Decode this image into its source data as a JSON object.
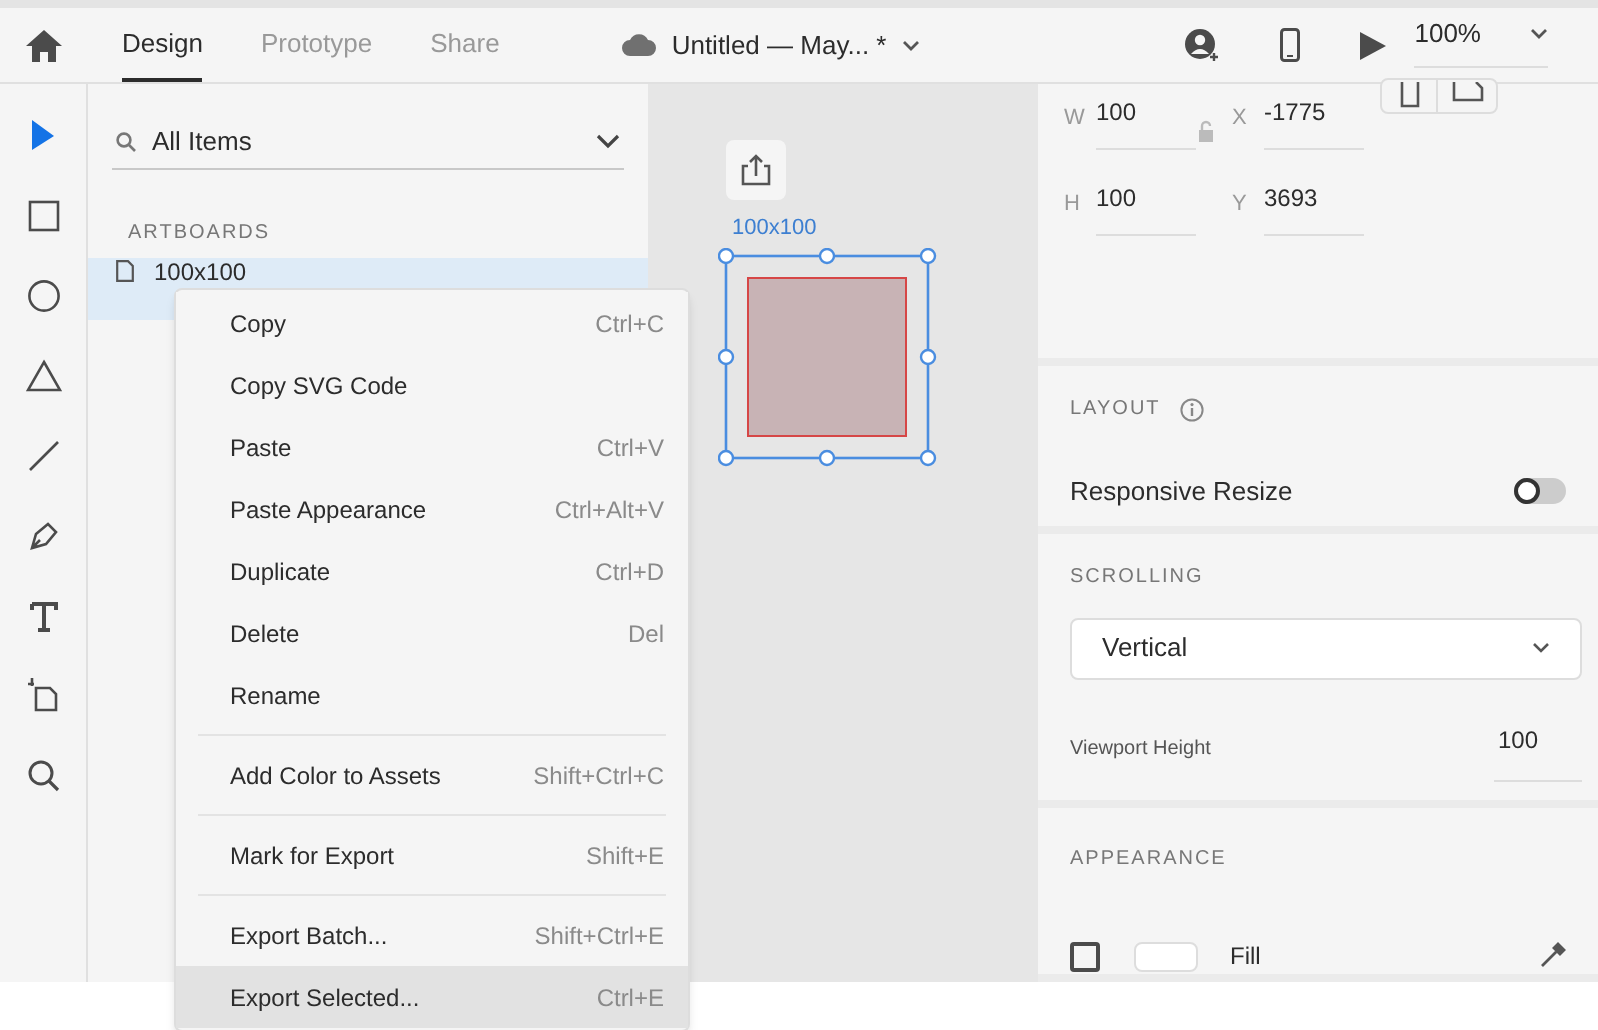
{
  "tabs": [
    {
      "label": "Design",
      "selected": true
    },
    {
      "label": "Prototype",
      "selected": false
    },
    {
      "label": "Share",
      "selected": false
    }
  ],
  "document_title": "Untitled — May... *",
  "zoom": "100%",
  "tools": [
    {
      "kind": "select",
      "selected": true
    },
    {
      "kind": "rectangle",
      "selected": false
    },
    {
      "kind": "ellipse",
      "selected": false
    },
    {
      "kind": "polygon",
      "selected": false
    },
    {
      "kind": "line",
      "selected": false
    },
    {
      "kind": "pen",
      "selected": false
    },
    {
      "kind": "text",
      "selected": false
    },
    {
      "kind": "artboard",
      "selected": false
    },
    {
      "kind": "zoom",
      "selected": false
    }
  ],
  "layers": {
    "filter": "All Items",
    "section": "ARTBOARDS",
    "items": [
      {
        "label": "100x100",
        "selected": true
      }
    ]
  },
  "canvas": {
    "artboard_label": "100x100"
  },
  "properties": {
    "fields": [
      {
        "label": "W",
        "value": "100"
      },
      {
        "label": "X",
        "value": "-1775"
      },
      {
        "label": "H",
        "value": "100"
      },
      {
        "label": "Y",
        "value": "3693"
      }
    ],
    "layout_title": "LAYOUT",
    "responsive_label": "Responsive Resize",
    "responsive_on": false,
    "scrolling_title": "SCROLLING",
    "scrolling_mode": "Vertical",
    "viewport_label": "Viewport Height",
    "viewport_value": "100",
    "appearance_title": "APPEARANCE",
    "fill_label": "Fill",
    "fill_checked": false
  },
  "context_menu": {
    "groups": [
      {
        "items": [
          {
            "label": "Copy",
            "shortcut": "Ctrl+C",
            "highlighted": false
          },
          {
            "label": "Copy SVG Code",
            "highlighted": false
          },
          {
            "label": "Paste",
            "shortcut": "Ctrl+V",
            "highlighted": false
          },
          {
            "label": "Paste Appearance",
            "shortcut": "Ctrl+Alt+V",
            "highlighted": false
          },
          {
            "label": "Duplicate",
            "shortcut": "Ctrl+D",
            "highlighted": false
          },
          {
            "label": "Delete",
            "shortcut": "Del",
            "highlighted": false
          },
          {
            "label": "Rename",
            "highlighted": false
          }
        ]
      },
      {
        "items": [
          {
            "label": "Add Color to Assets",
            "shortcut": "Shift+Ctrl+C",
            "highlighted": false
          }
        ]
      },
      {
        "items": [
          {
            "label": "Mark for Export",
            "shortcut": "Shift+E",
            "highlighted": false
          }
        ]
      },
      {
        "items": [
          {
            "label": "Export Batch...",
            "shortcut": "Shift+Ctrl+E",
            "highlighted": false
          },
          {
            "label": "Export Selected...",
            "shortcut": "Ctrl+E",
            "highlighted": true
          }
        ]
      }
    ]
  }
}
